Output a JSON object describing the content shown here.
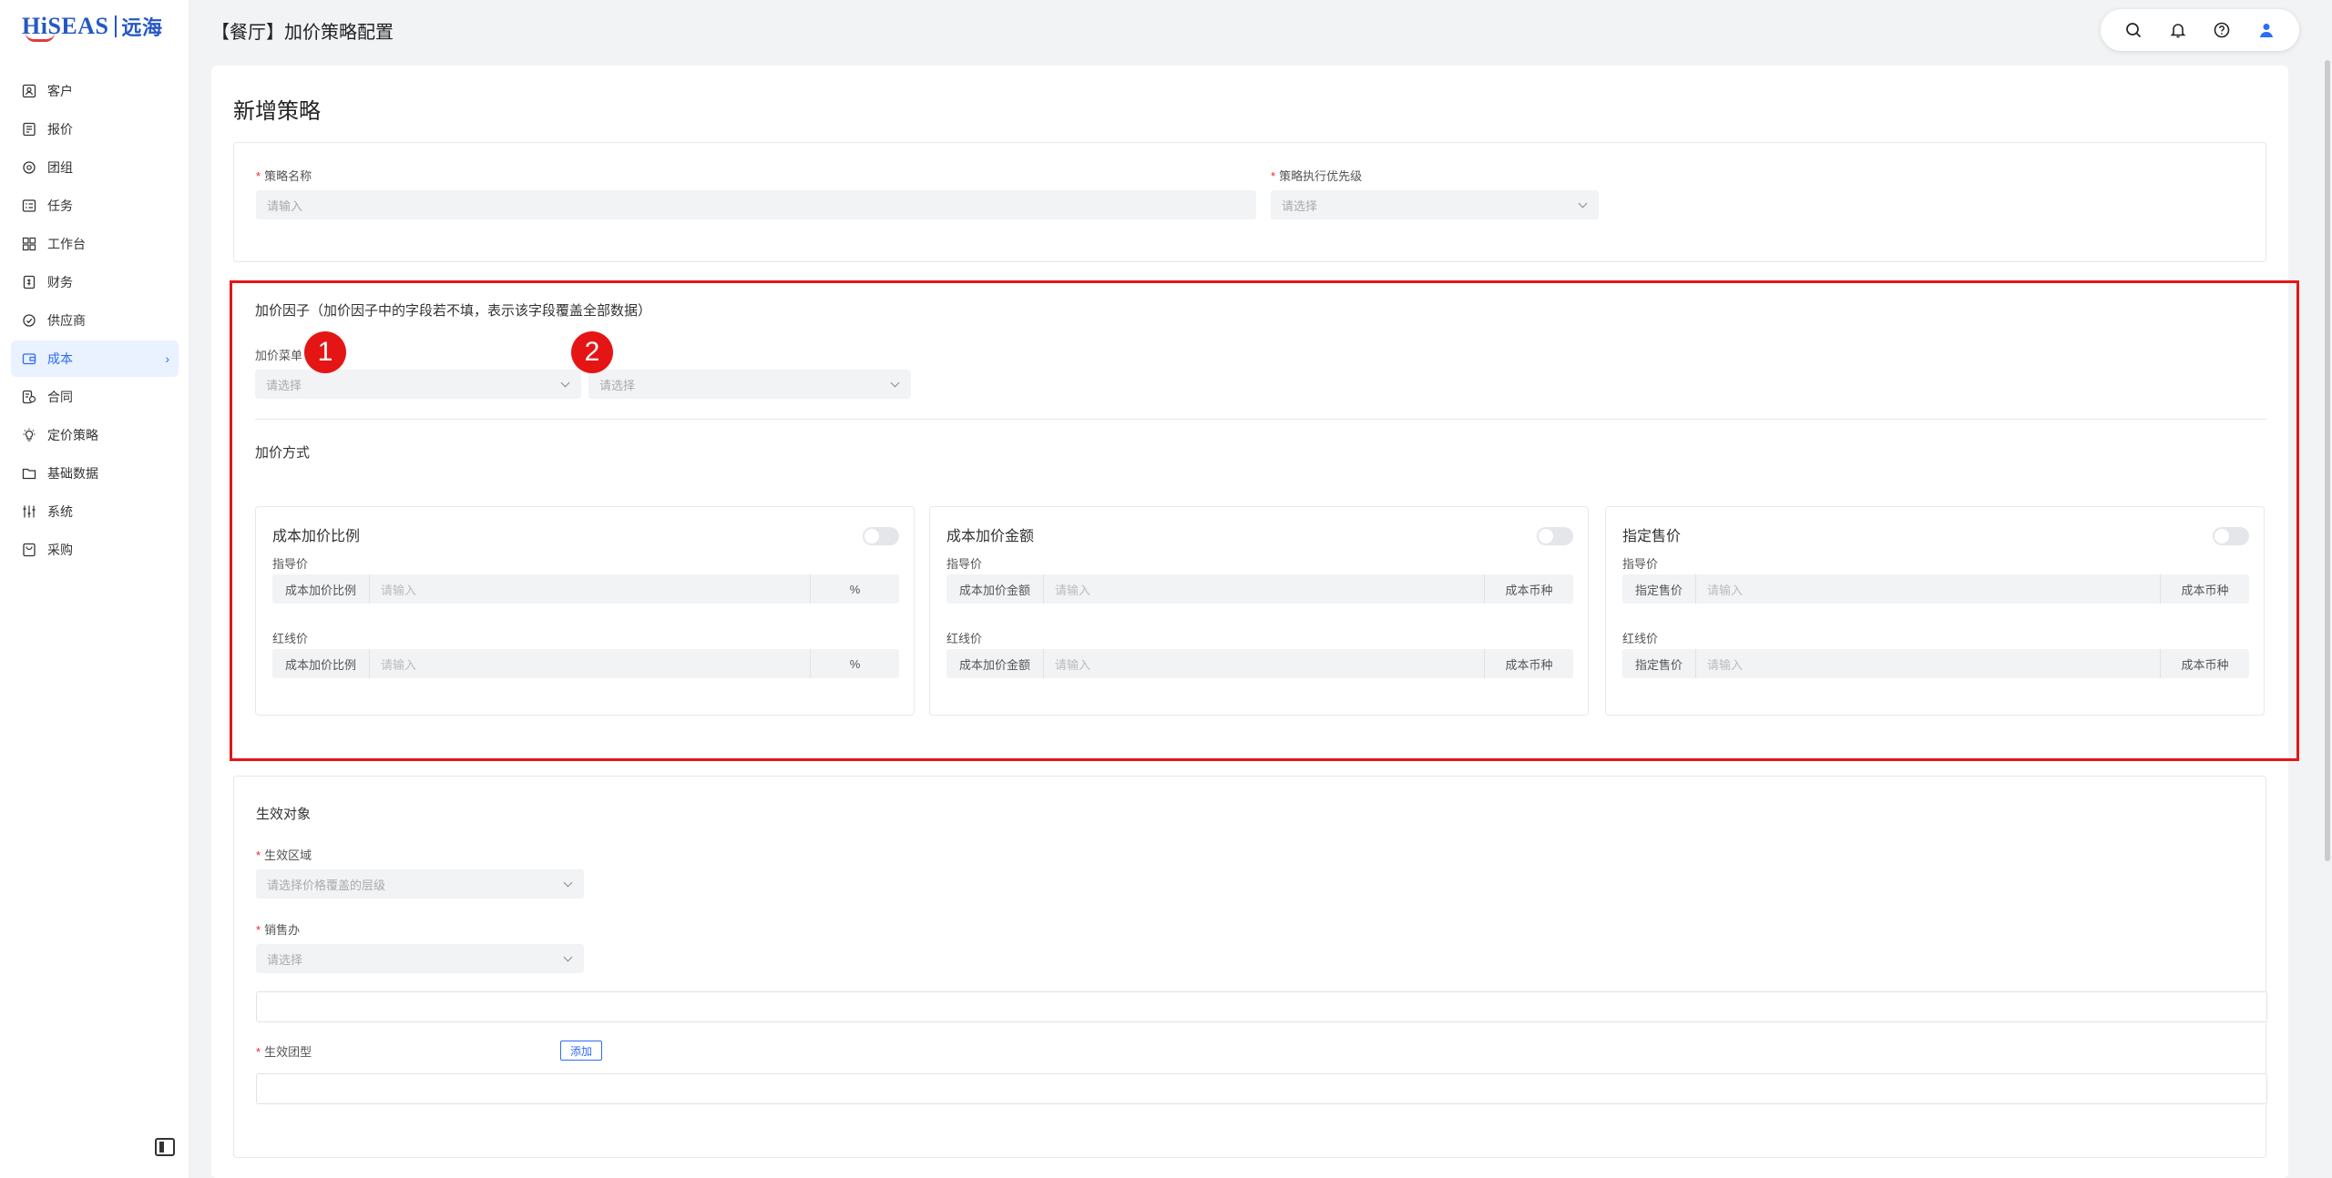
{
  "brand": {
    "name": "HiSEAS",
    "name_cn": "远海"
  },
  "header": {
    "title": "【餐厅】加价策略配置"
  },
  "sidebar": {
    "items": [
      {
        "label": "客户",
        "icon": "customer-icon"
      },
      {
        "label": "报价",
        "icon": "quote-icon"
      },
      {
        "label": "团组",
        "icon": "group-icon"
      },
      {
        "label": "任务",
        "icon": "task-icon"
      },
      {
        "label": "工作台",
        "icon": "workbench-icon"
      },
      {
        "label": "财务",
        "icon": "finance-icon"
      },
      {
        "label": "供应商",
        "icon": "supplier-icon"
      },
      {
        "label": "成本",
        "icon": "cost-icon",
        "active": true
      },
      {
        "label": "合同",
        "icon": "contract-icon"
      },
      {
        "label": "定价策略",
        "icon": "pricing-icon"
      },
      {
        "label": "基础数据",
        "icon": "basic-data-icon"
      },
      {
        "label": "系统",
        "icon": "system-icon"
      },
      {
        "label": "采购",
        "icon": "purchase-icon"
      }
    ]
  },
  "page": {
    "section_title": "新增策略"
  },
  "basic": {
    "name_label": "策略名称",
    "name_placeholder": "请输入",
    "priority_label": "策略执行优先级",
    "priority_placeholder": "请选择"
  },
  "factor": {
    "title": "加价因子（加价因子中的字段若不填，表示该字段覆盖全部数据）",
    "dish_label": "加价菜单",
    "select1_placeholder": "请选择",
    "select2_placeholder": "请选择",
    "badge1": "1",
    "badge2": "2"
  },
  "method": {
    "title": "加价方式",
    "guide_label": "指导价",
    "redline_label": "红线价",
    "input_placeholder": "请输入",
    "cards": [
      {
        "title": "成本加价比例",
        "prefix": "成本加价比例",
        "suffix": "%"
      },
      {
        "title": "成本加价金额",
        "prefix": "成本加价金额",
        "suffix": "成本币种"
      },
      {
        "title": "指定售价",
        "prefix": "指定售价",
        "suffix": "成本币种"
      }
    ]
  },
  "target": {
    "title": "生效对象",
    "region_label": "生效区域",
    "region_placeholder": "请选择价格覆盖的层级",
    "office_label": "销售办",
    "office_placeholder": "请选择",
    "group_type_label": "生效团型",
    "add_button": "添加"
  },
  "colors": {
    "accent": "#2d6cf6",
    "highlight": "#e51515",
    "required": "#f5222d"
  }
}
